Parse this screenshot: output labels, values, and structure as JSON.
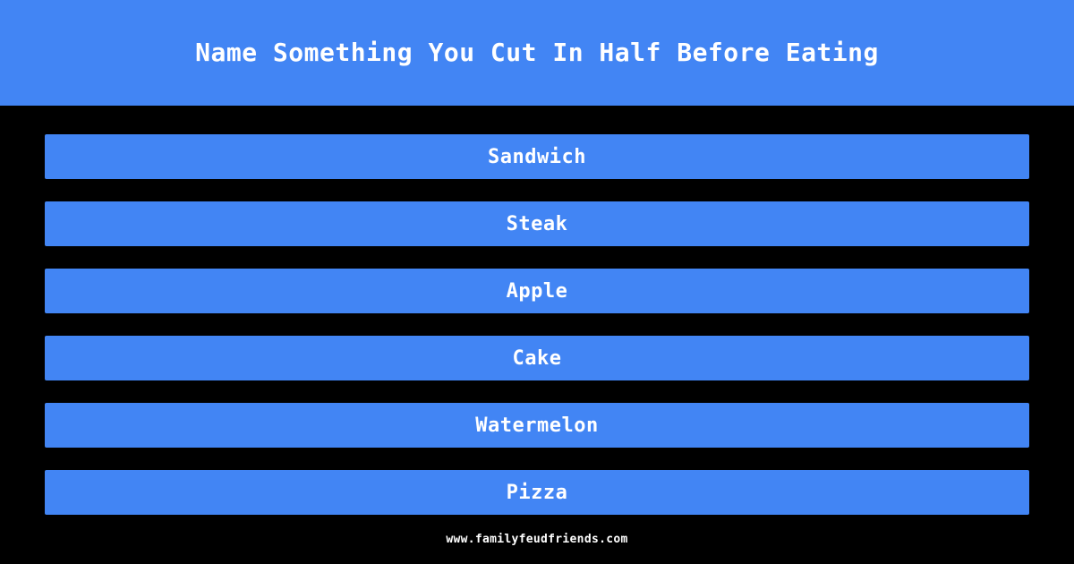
{
  "theme": {
    "background": "#000000",
    "accent": "#4285f4",
    "text_on_accent": "#ffffff",
    "footer_text_color": "#ffffff"
  },
  "header": {
    "question": "Name Something You Cut In Half Before Eating"
  },
  "answers": [
    {
      "label": "Sandwich"
    },
    {
      "label": "Steak"
    },
    {
      "label": "Apple"
    },
    {
      "label": "Cake"
    },
    {
      "label": "Watermelon"
    },
    {
      "label": "Pizza"
    }
  ],
  "footer": {
    "site": "www.familyfeudfriends.com"
  }
}
